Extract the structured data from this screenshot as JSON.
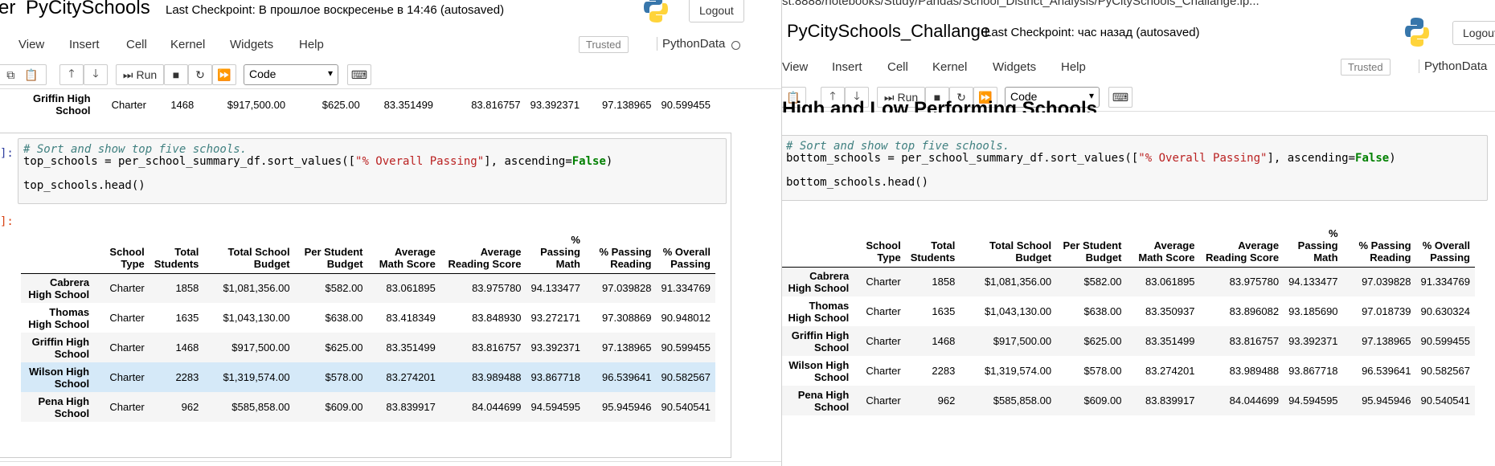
{
  "left": {
    "title": "PyCitySchools",
    "title_fragment": "er",
    "checkpoint": "Last Checkpoint: В прошлое воскресенье в 14:46  (autosaved)",
    "logout": "Logout",
    "menu": [
      "View",
      "Insert",
      "Cell",
      "Kernel",
      "Widgets",
      "Help"
    ],
    "trusted": "Trusted",
    "kernel_name": "PythonData",
    "run_label": "Run",
    "cell_type": "Code",
    "top_row": [
      "Griffin High School",
      "Charter",
      "1468",
      "$917,500.00",
      "$625.00",
      "83.351499",
      "83.816757",
      "93.392371",
      "97.138965",
      "90.599455"
    ],
    "in_prompt": "]:",
    "out_prompt": "]:",
    "code": {
      "comment": "# Sort and show top five schools.",
      "line2_a": "top_schools = per_school_summary_df.sort_values([",
      "line2_str": "\"% Overall Passing\"",
      "line2_b": "], ascending=",
      "line2_kw": "False",
      "line2_c": ")",
      "line3": "top_schools.head()"
    },
    "rows": [
      [
        "Cabrera High School",
        "Charter",
        "1858",
        "$1,081,356.00",
        "$582.00",
        "83.061895",
        "83.975780",
        "94.133477",
        "97.039828",
        "91.334769"
      ],
      [
        "Thomas High School",
        "Charter",
        "1635",
        "$1,043,130.00",
        "$638.00",
        "83.418349",
        "83.848930",
        "93.272171",
        "97.308869",
        "90.948012"
      ],
      [
        "Griffin High School",
        "Charter",
        "1468",
        "$917,500.00",
        "$625.00",
        "83.351499",
        "83.816757",
        "93.392371",
        "97.138965",
        "90.599455"
      ],
      [
        "Wilson High School",
        "Charter",
        "2283",
        "$1,319,574.00",
        "$578.00",
        "83.274201",
        "83.989488",
        "93.867718",
        "96.539641",
        "90.582567"
      ],
      [
        "Pena High School",
        "Charter",
        "962",
        "$585,858.00",
        "$609.00",
        "83.839917",
        "84.044699",
        "94.594595",
        "95.945946",
        "90.540541"
      ]
    ]
  },
  "right": {
    "url": "st:8888/notebooks/Study/Pandas/School_District_Analysis/PyCitySchools_Challange.ip...",
    "title": "PyCitySchools_Challange",
    "checkpoint": "Last Checkpoint: час назад  (autosaved)",
    "logout": "Logout",
    "menu": [
      "View",
      "Insert",
      "Cell",
      "Kernel",
      "Widgets",
      "Help"
    ],
    "trusted": "Trusted",
    "kernel_name": "PythonData",
    "run_label": "Run",
    "cell_type": "Code",
    "partial_heading": "High and Low Performing Schools",
    "code": {
      "comment": "# Sort and show top five schools.",
      "line2_a": "bottom_schools = per_school_summary_df.sort_values([",
      "line2_str": "\"% Overall Passing\"",
      "line2_b": "], ascending=",
      "line2_kw": "False",
      "line2_c": ")",
      "line3": "bottom_schools.head()"
    },
    "rows": [
      [
        "Cabrera High School",
        "Charter",
        "1858",
        "$1,081,356.00",
        "$582.00",
        "83.061895",
        "83.975780",
        "94.133477",
        "97.039828",
        "91.334769"
      ],
      [
        "Thomas High School",
        "Charter",
        "1635",
        "$1,043,130.00",
        "$638.00",
        "83.350937",
        "83.896082",
        "93.185690",
        "97.018739",
        "90.630324"
      ],
      [
        "Griffin High School",
        "Charter",
        "1468",
        "$917,500.00",
        "$625.00",
        "83.351499",
        "83.816757",
        "93.392371",
        "97.138965",
        "90.599455"
      ],
      [
        "Wilson High School",
        "Charter",
        "2283",
        "$1,319,574.00",
        "$578.00",
        "83.274201",
        "83.989488",
        "93.867718",
        "96.539641",
        "90.582567"
      ],
      [
        "Pena High School",
        "Charter",
        "962",
        "$585,858.00",
        "$609.00",
        "83.839917",
        "84.044699",
        "94.594595",
        "95.945946",
        "90.540541"
      ]
    ]
  },
  "columns": [
    "School Type",
    "Total Students",
    "Total School Budget",
    "Per Student Budget",
    "Average Math Score",
    "Average Reading Score",
    "% Passing Math",
    "% Passing Reading",
    "% Overall Passing"
  ]
}
